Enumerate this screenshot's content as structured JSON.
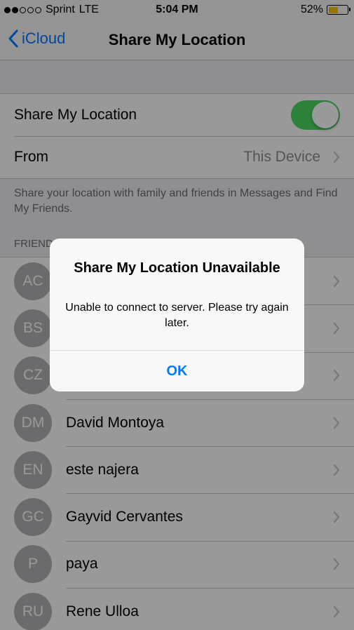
{
  "status_bar": {
    "carrier": "Sprint",
    "network": "LTE",
    "time": "5:04 PM",
    "battery_percent": "52%",
    "battery_level": 0.52,
    "signal_bars": 2,
    "signal_total": 5
  },
  "nav": {
    "back_label": "iCloud",
    "title": "Share My Location"
  },
  "settings": {
    "share_label": "Share My Location",
    "share_enabled": true,
    "from_label": "From",
    "from_value": "This Device"
  },
  "footer_note": "Share your location with family and friends in Messages and Find My Friends.",
  "friends_header": "FRIENDS",
  "friends": [
    {
      "initials": "AC",
      "name": ""
    },
    {
      "initials": "BS",
      "name": ""
    },
    {
      "initials": "CZ",
      "name": ""
    },
    {
      "initials": "DM",
      "name": "David Montoya"
    },
    {
      "initials": "EN",
      "name": "este najera"
    },
    {
      "initials": "GC",
      "name": "Gayvid Cervantes"
    },
    {
      "initials": "P",
      "name": "paya"
    },
    {
      "initials": "RU",
      "name": "Rene Ulloa"
    }
  ],
  "alert": {
    "title": "Share My Location Unavailable",
    "message": "Unable to connect to server. Please try again later.",
    "button": "OK"
  },
  "colors": {
    "accent": "#007aff",
    "toggle_on": "#4cd964",
    "battery": "#f5c400"
  }
}
